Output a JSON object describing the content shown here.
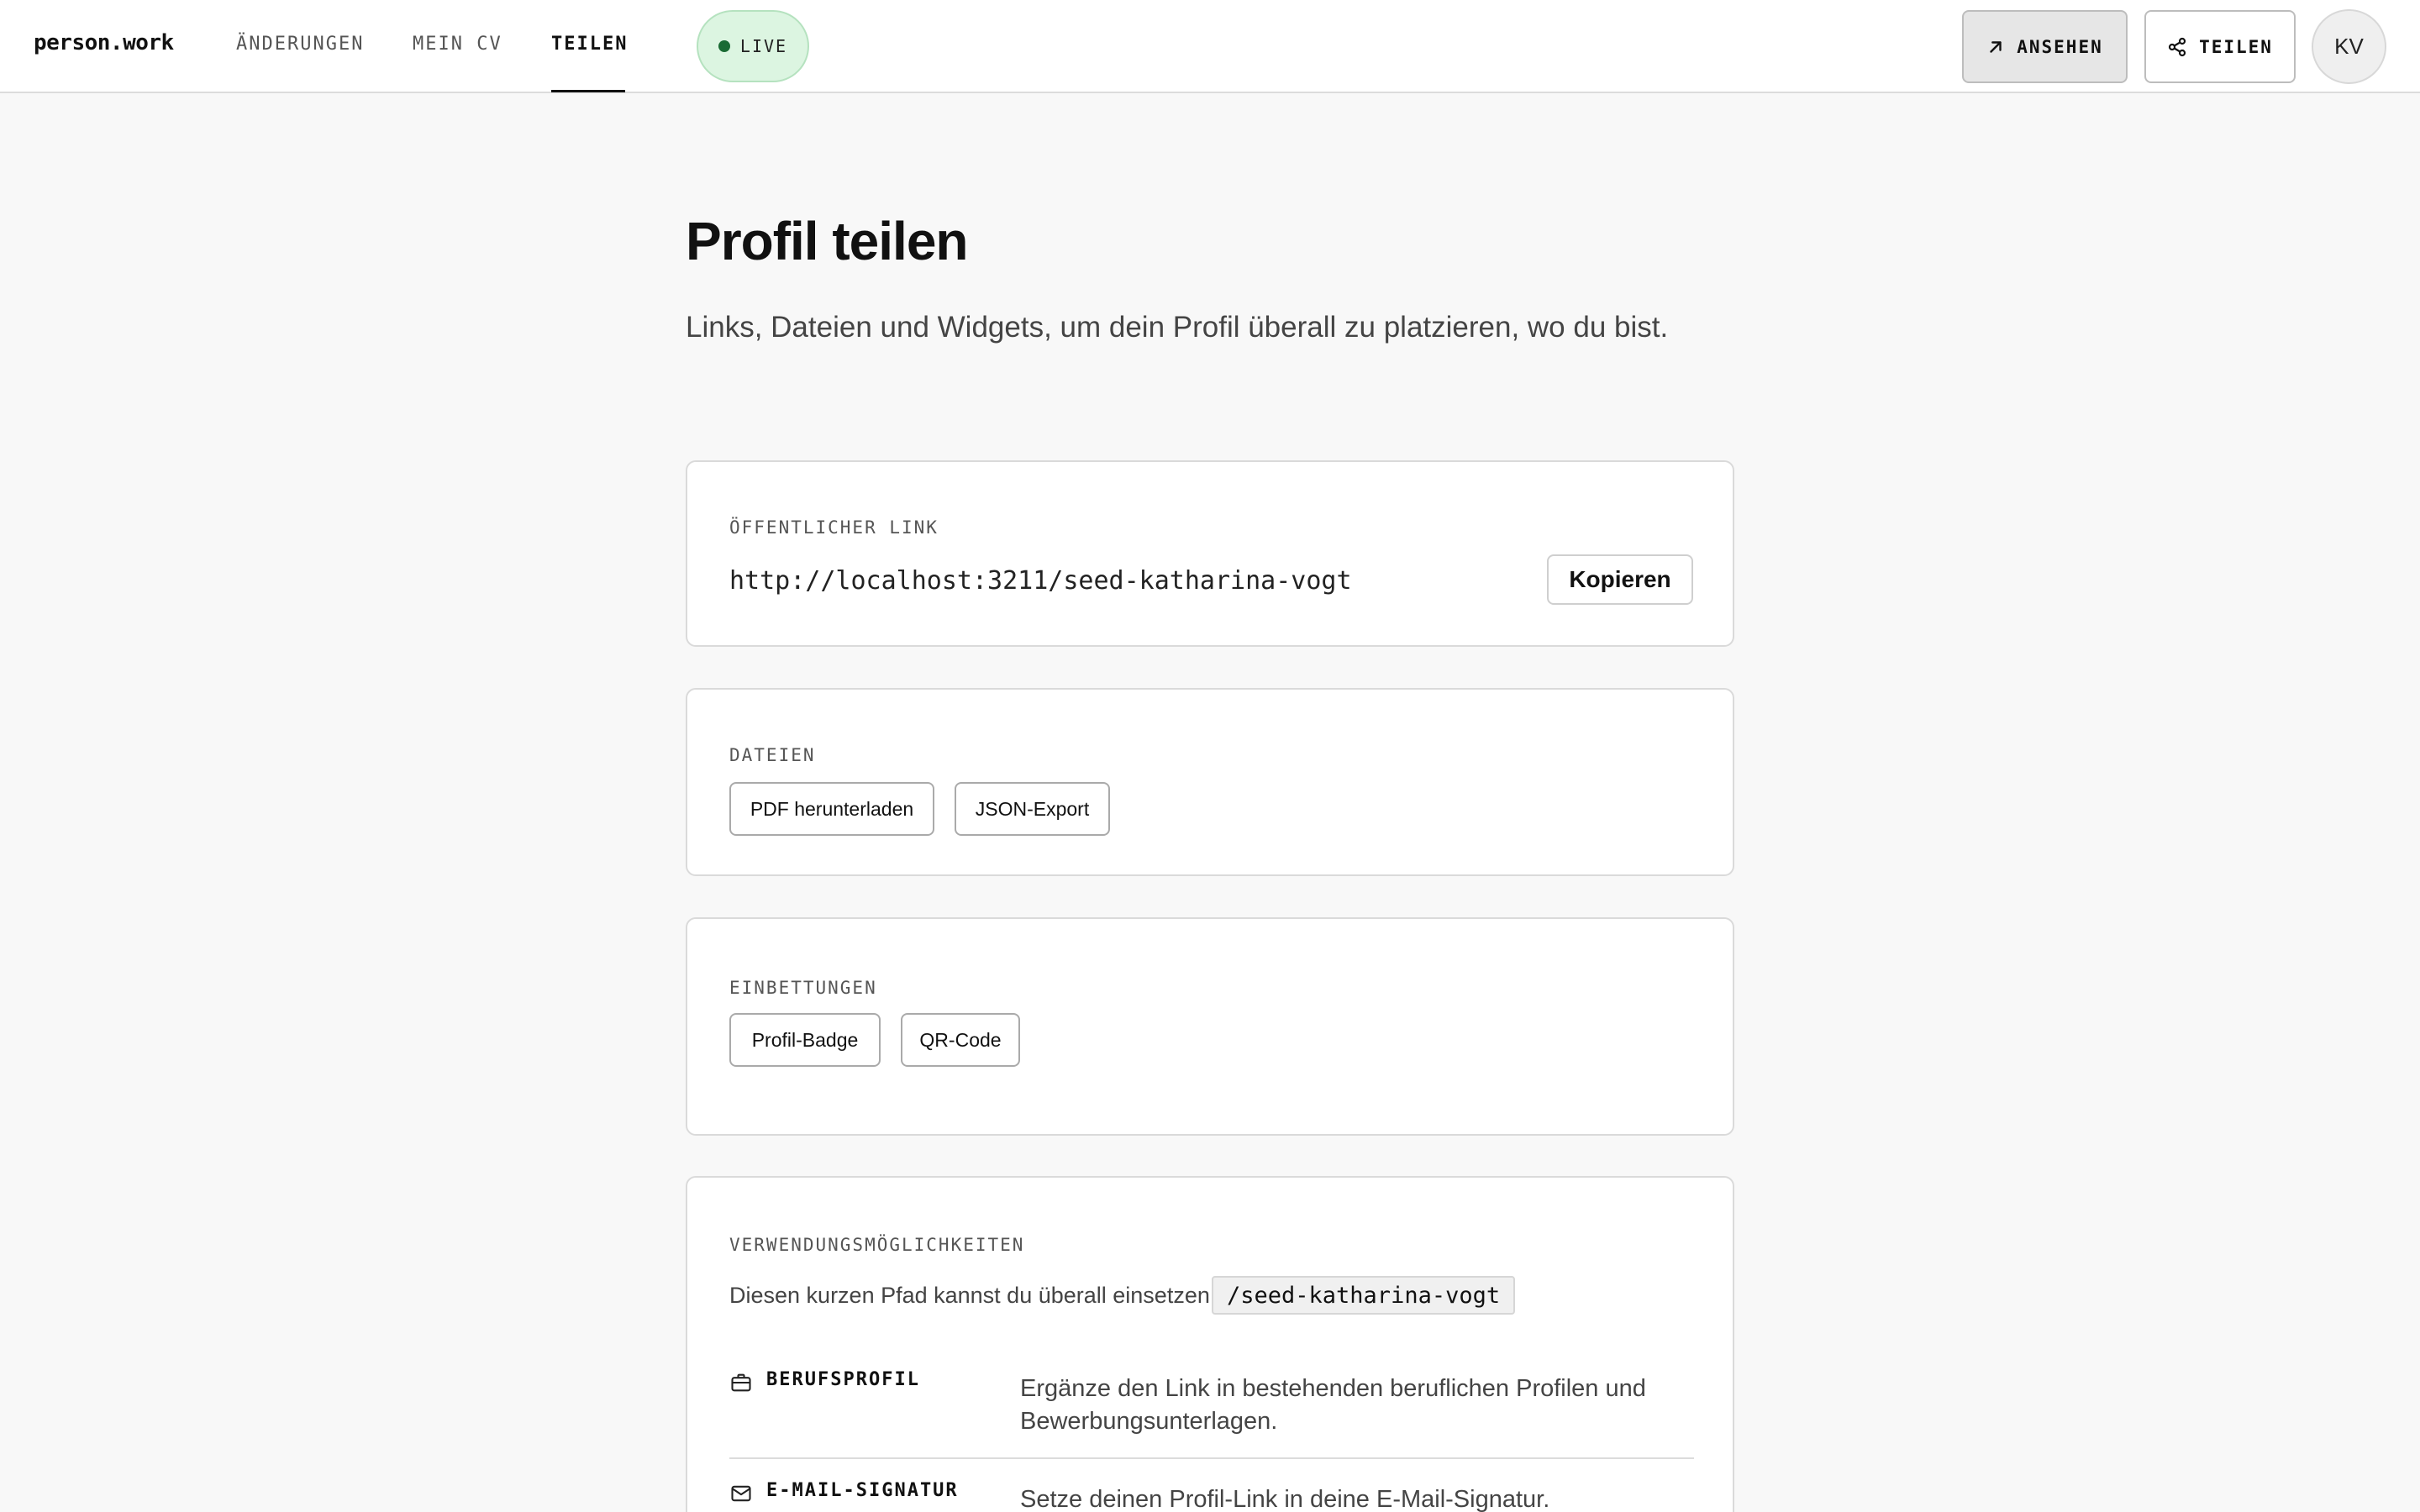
{
  "header": {
    "logo": "person.work",
    "nav": [
      {
        "label": "ÄNDERUNGEN",
        "active": false
      },
      {
        "label": "MEIN CV",
        "active": false
      },
      {
        "label": "TEILEN",
        "active": true
      }
    ],
    "live_label": "LIVE",
    "view_label": "ANSEHEN",
    "share_label": "TEILEN",
    "avatar_initials": "KV"
  },
  "main": {
    "title": "Profil teilen",
    "subtitle": "Links, Dateien und Widgets, um dein Profil überall zu platzieren, wo du bist.",
    "public_link": {
      "label": "ÖFFENTLICHER LINK",
      "url": "http://localhost:3211/seed-katharina-vogt",
      "copy_label": "Kopieren"
    },
    "files": {
      "label": "DATEIEN",
      "buttons": [
        "PDF herunterladen",
        "JSON-Export"
      ]
    },
    "embeds": {
      "label": "EINBETTUNGEN",
      "buttons": [
        "Profil-Badge",
        "QR-Code"
      ]
    },
    "uses": {
      "label": "VERWENDUNGSMÖGLICHKEITEN",
      "path_text": "Diesen kurzen Pfad kannst du überall einsetzen:",
      "path": "/seed-katharina-vogt",
      "items": [
        {
          "icon": "briefcase-icon",
          "name": "BERUFSPROFIL",
          "description": "Ergänze den Link in bestehenden beruflichen Profilen und Bewerbungsunterlagen."
        },
        {
          "icon": "mail-icon",
          "name": "E-MAIL-SIGNATUR",
          "description": "Setze deinen Profil-Link in deine E-Mail-Signatur."
        }
      ]
    }
  },
  "colors": {
    "live_bg": "#dcf5e1",
    "live_dot": "#1a6b34",
    "page_bg": "#f8f8f8"
  }
}
